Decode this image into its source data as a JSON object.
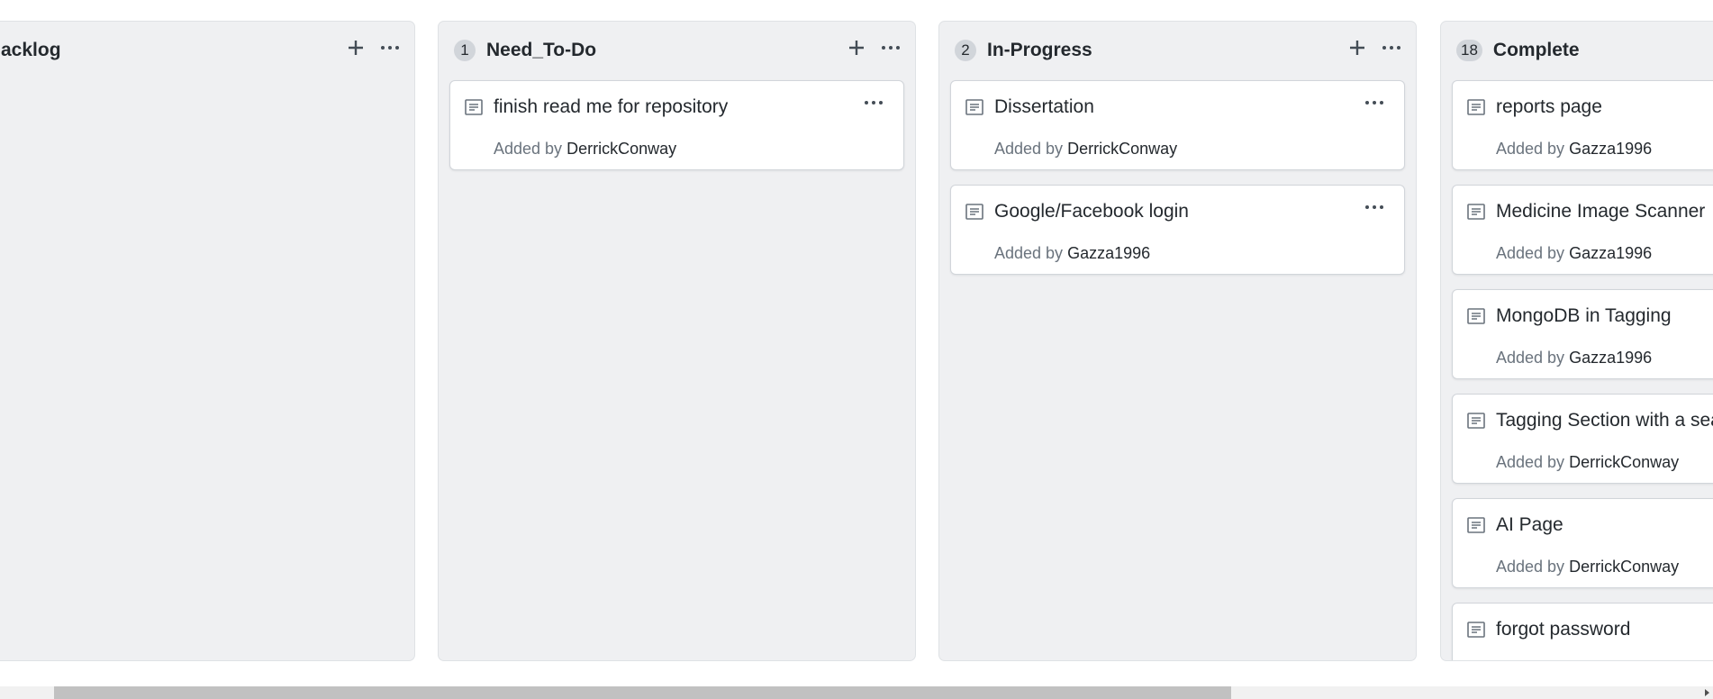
{
  "columns": [
    {
      "title": "acklog",
      "count": "",
      "cards": []
    },
    {
      "title": "Need_To-Do",
      "count": "1",
      "cards": [
        {
          "title": "finish read me for repository",
          "added_prefix": "Added by",
          "author": "DerrickConway"
        }
      ]
    },
    {
      "title": "In-Progress",
      "count": "2",
      "cards": [
        {
          "title": "Dissertation",
          "added_prefix": "Added by",
          "author": "DerrickConway"
        },
        {
          "title": "Google/Facebook login",
          "added_prefix": "Added by",
          "author": "Gazza1996"
        }
      ]
    },
    {
      "title": "Complete",
      "count": "18",
      "cards": [
        {
          "title": "reports page",
          "added_prefix": "Added by",
          "author": "Gazza1996"
        },
        {
          "title": "Medicine Image Scanner",
          "added_prefix": "Added by",
          "author": "Gazza1996"
        },
        {
          "title": "MongoDB in Tagging",
          "added_prefix": "Added by",
          "author": "Gazza1996"
        },
        {
          "title": "Tagging Section with a sea",
          "added_prefix": "Added by",
          "author": "DerrickConway"
        },
        {
          "title": "AI Page",
          "added_prefix": "Added by",
          "author": "DerrickConway"
        },
        {
          "title": "forgot password",
          "added_prefix": "",
          "author": ""
        }
      ]
    }
  ],
  "icons": {
    "add": "plus-icon",
    "menu": "kebab-horizontal-icon",
    "note": "note-icon"
  },
  "colors": {
    "column_bg": "#eff0f2",
    "card_bg": "#ffffff",
    "badge_bg": "#d1d5da",
    "meta_text": "#6a737d"
  },
  "scrollbar": {
    "horizontal_position_fraction": 0.03
  }
}
